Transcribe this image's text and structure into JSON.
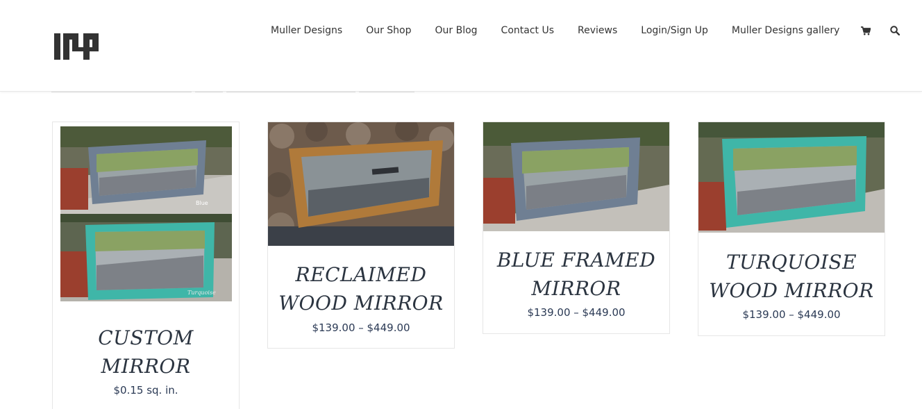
{
  "header": {
    "logo_alt": "Muller Designs logo",
    "nav": [
      {
        "label": "Muller Designs"
      },
      {
        "label": "Our Shop"
      },
      {
        "label": "Our Blog"
      },
      {
        "label": "Contact Us"
      },
      {
        "label": "Reviews"
      },
      {
        "label": "Login/Sign Up"
      },
      {
        "label": "Muller Designs gallery"
      }
    ],
    "cart_icon": "shopping-cart-icon",
    "search_icon": "search-icon"
  },
  "products": [
    {
      "title_line1": "CUSTOM",
      "title_line2": "MIRROR",
      "price": "$0.15 sq. in.",
      "img_labels": [
        "Blue",
        "Turquoise"
      ]
    },
    {
      "title_line1": "RECLAIMED",
      "title_line2": "WOOD MIRROR",
      "price": "$139.00 – $449.00"
    },
    {
      "title_line1": "BLUE FRAMED",
      "title_line2": "MIRROR",
      "price": "$139.00 – $449.00"
    },
    {
      "title_line1": "TURQUOISE",
      "title_line2": "WOOD MIRROR",
      "price": "$139.00 – $449.00"
    }
  ],
  "colors": {
    "title": "#2b3440",
    "price": "#2b3a55",
    "frame_blue": "#6f7f93",
    "frame_turquoise": "#3fb6a8",
    "frame_wood": "#b07a3a"
  }
}
